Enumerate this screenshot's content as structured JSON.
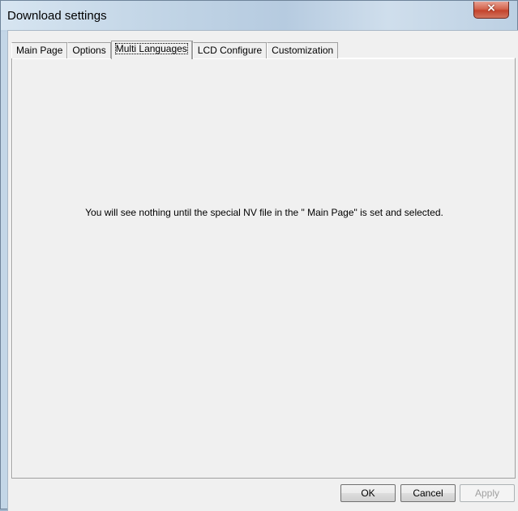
{
  "window": {
    "title": "Download settings",
    "close_glyph": "×"
  },
  "tabs": [
    {
      "label": "Main Page"
    },
    {
      "label": "Options"
    },
    {
      "label": "Multi Languages",
      "active": true
    },
    {
      "label": "LCD Configure"
    },
    {
      "label": "Customization"
    }
  ],
  "panel": {
    "message": "You will see nothing until the special NV file in the \" Main Page\" is set and selected."
  },
  "buttons": {
    "ok": "OK",
    "cancel": "Cancel",
    "apply": "Apply"
  },
  "icons": {
    "close": "close-icon"
  }
}
